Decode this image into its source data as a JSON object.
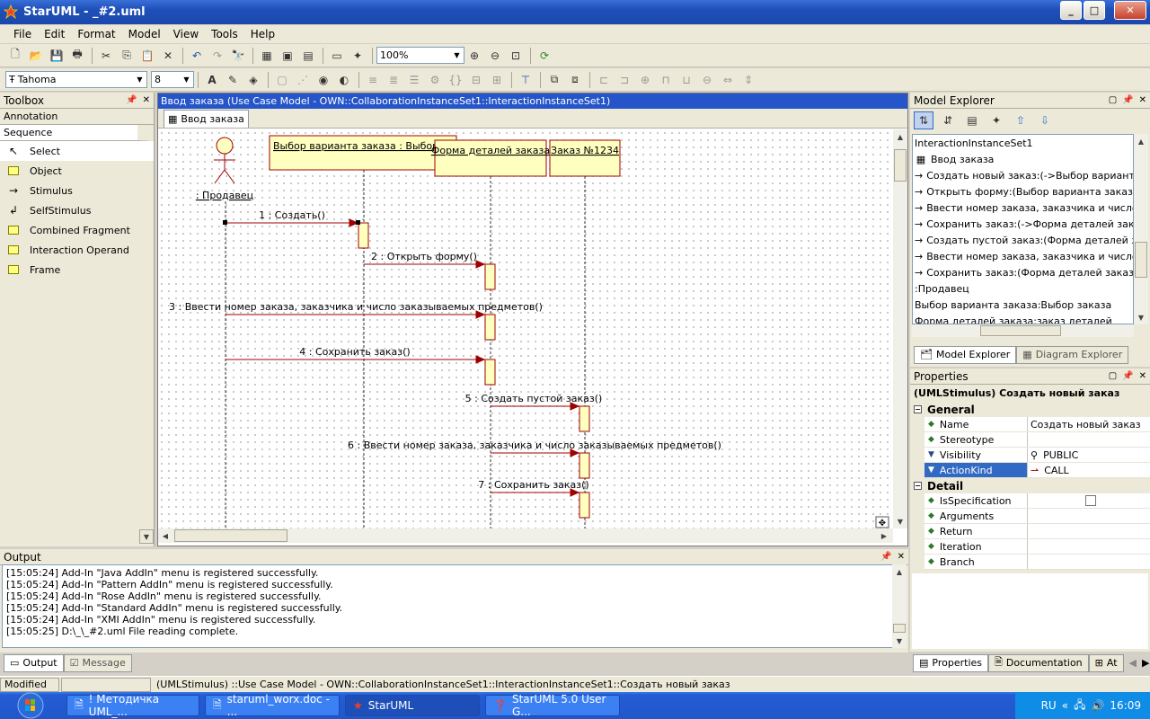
{
  "window": {
    "title": "StarUML - _#2.uml",
    "min": "_",
    "max": "□",
    "close": "✕"
  },
  "menu": [
    "File",
    "Edit",
    "Format",
    "Model",
    "View",
    "Tools",
    "Help"
  ],
  "toolbar": {
    "zoom": "100%",
    "font": "Tahoma",
    "font_size": "8"
  },
  "toolbox": {
    "title": "Toolbox",
    "categories": [
      "Annotation",
      "Sequence"
    ],
    "items": [
      {
        "label": "Select",
        "icon": "cursor-icon"
      },
      {
        "label": "Object",
        "icon": "object-icon"
      },
      {
        "label": "Stimulus",
        "icon": "arrow-icon"
      },
      {
        "label": "SelfStimulus",
        "icon": "self-arrow-icon"
      },
      {
        "label": "Combined Fragment",
        "icon": "fragment-icon"
      },
      {
        "label": "Interaction Operand",
        "icon": "operand-icon"
      },
      {
        "label": "Frame",
        "icon": "frame-icon"
      }
    ]
  },
  "diagram": {
    "title": "Ввод заказа (Use Case Model - OWN::CollaborationInstanceSet1::InteractionInstanceSet1)",
    "tab": "Ввод заказа",
    "actor": ": Продавец",
    "objects": [
      "Выбор варианта заказа : Выбор заказа",
      "Форма деталей заказа",
      "Заказ №1234"
    ],
    "messages": [
      "1 : Создать()",
      "2 : Открыть форму()",
      "3 : Ввести номер заказа, заказчика и число заказываемых предметов()",
      "4 : Сохранить заказ()",
      "5 : Создать пустой заказ()",
      "6 : Ввести номер заказа, заказчика и число заказываемых предметов()",
      "7 : Сохранить заказ()"
    ]
  },
  "explorer": {
    "title": "Model Explorer",
    "items": [
      "InteractionInstanceSet1",
      "Ввод заказа",
      "Создать новый заказ:(->Выбор варианта за",
      "Открыть форму:(Выбор варианта заказа->Ф",
      "Ввести номер заказа, заказчика и число зак",
      "Сохранить заказ:(->Форма деталей заказа)",
      "Создать пустой заказ:(Форма деталей заказ",
      "Ввести номер заказа, заказчика и число зак",
      "Сохранить заказ:(Форма деталей заказа->З",
      ":Продавец",
      "Выбор варианта заказа:Выбор заказа",
      "Форма деталей заказа:заказ деталей"
    ],
    "tabs": [
      "Model Explorer",
      "Diagram Explorer"
    ]
  },
  "properties": {
    "title": "Properties",
    "header": "(UMLStimulus) Создать новый заказ",
    "groups": [
      {
        "name": "General",
        "rows": [
          {
            "name": "Name",
            "value": "Создать новый заказ"
          },
          {
            "name": "Stereotype",
            "value": ""
          },
          {
            "name": "Visibility",
            "value": "PUBLIC"
          },
          {
            "name": "ActionKind",
            "value": "CALL"
          }
        ]
      },
      {
        "name": "Detail",
        "rows": [
          {
            "name": "IsSpecification",
            "value": ""
          },
          {
            "name": "Arguments",
            "value": ""
          },
          {
            "name": "Return",
            "value": ""
          },
          {
            "name": "Iteration",
            "value": ""
          },
          {
            "name": "Branch",
            "value": ""
          }
        ]
      }
    ],
    "tabs": [
      "Properties",
      "Documentation",
      "At"
    ]
  },
  "output": {
    "title": "Output",
    "lines": [
      "[15:05:24]  Add-In \"Java AddIn\" menu is registered successfully.",
      "[15:05:24]  Add-In \"Pattern AddIn\" menu is registered successfully.",
      "[15:05:24]  Add-In \"Rose AddIn\" menu is registered successfully.",
      "[15:05:24]  Add-In \"Standard AddIn\" menu is registered successfully.",
      "[15:05:24]  Add-In \"XMI AddIn\" menu is registered successfully.",
      "[15:05:25]  D:\\_\\_#2.uml File reading complete."
    ],
    "tabs": [
      "Output",
      "Message"
    ]
  },
  "status": {
    "modified": "Modified",
    "path": "(UMLStimulus) ::Use Case Model - OWN::CollaborationInstanceSet1::InteractionInstanceSet1::Создать новый заказ"
  },
  "taskbar": {
    "tasks": [
      "! Методичка UML_...",
      "staruml_worx.doc - ...",
      "StarUML",
      "StarUML 5.0 User G..."
    ],
    "lang": "RU",
    "time": "16:09"
  }
}
